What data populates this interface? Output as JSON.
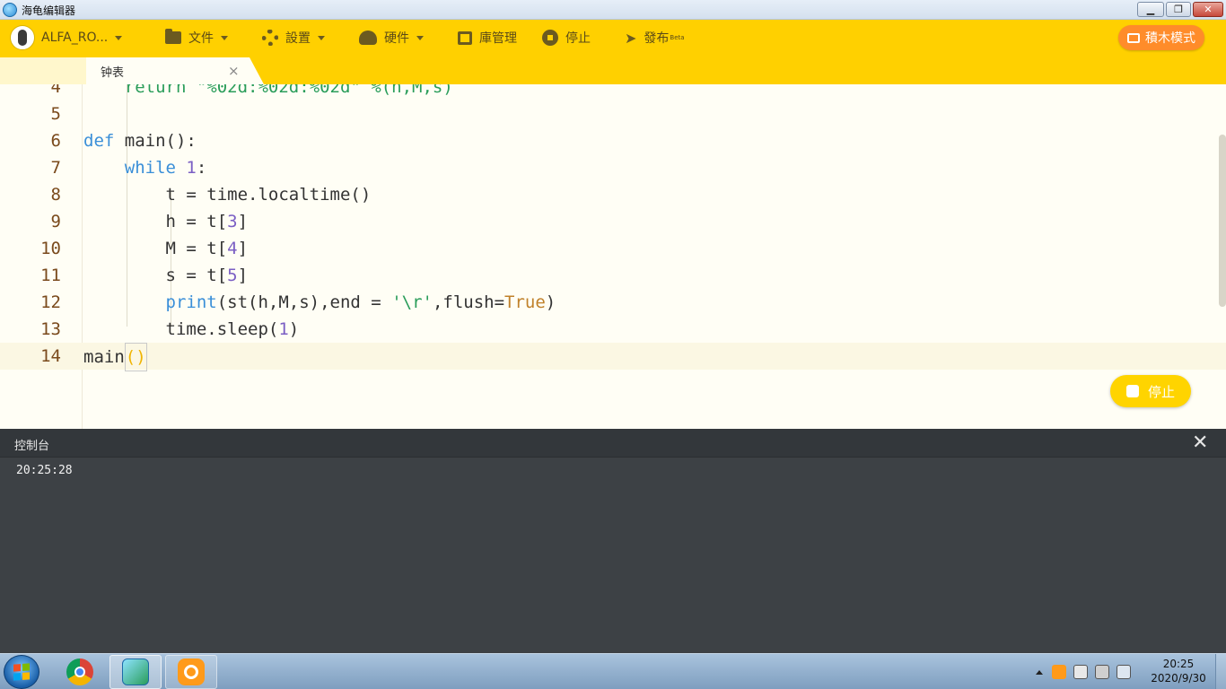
{
  "window": {
    "title": "海龟编辑器",
    "min_glyph": "▁",
    "max_glyph": "❐",
    "close_glyph": "✕"
  },
  "toolbar": {
    "device": "ALFA_RO...",
    "file": "文件",
    "settings": "設置",
    "hardware": "硬件",
    "library": "庫管理",
    "stop": "停止",
    "publish": "發布",
    "publish_badge": "Beta",
    "blocks_mode": "積木模式"
  },
  "tabs": [
    {
      "label": "钟表",
      "close": "×"
    }
  ],
  "editor": {
    "line_numbers": [
      "4",
      "5",
      "6",
      "7",
      "8",
      "9",
      "10",
      "11",
      "12",
      "13",
      "14"
    ],
    "line4_partial": "    return \"%02d:%02d:%02d\" %(h,M,s)",
    "run_stop_button": "停止"
  },
  "console": {
    "title": "控制台",
    "close_glyph": "✕",
    "output": "20:25:28"
  },
  "taskbar": {
    "time": "20:25",
    "date": "2020/9/30"
  },
  "colors": {
    "toolbar": "#ffd000",
    "accent_orange": "#ff8c2a",
    "keyword": "#3a8fd8",
    "number": "#7b5fc4",
    "string": "#2a9d5a",
    "console_bg": "#3d4145"
  }
}
